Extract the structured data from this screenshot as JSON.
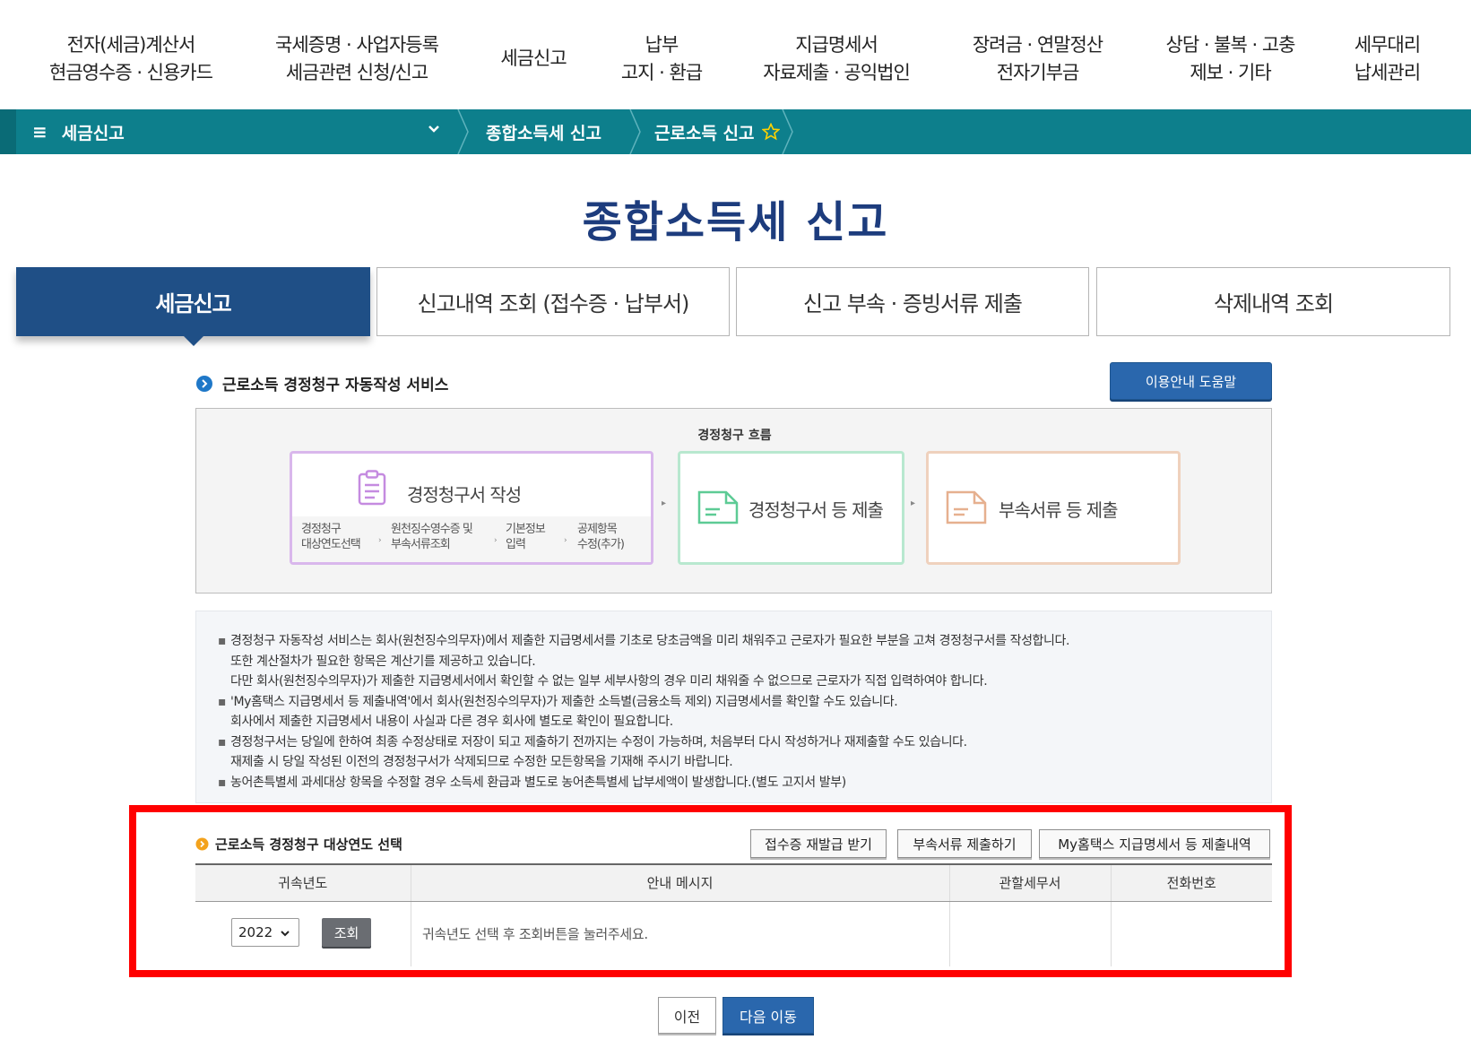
{
  "topnav": [
    {
      "line1": "전자(세금)계산서",
      "line2": "현금영수증 · 신용카드"
    },
    {
      "line1": "국세증명 · 사업자등록",
      "line2": "세금관련 신청/신고"
    },
    {
      "line1": "세금신고",
      "line2": ""
    },
    {
      "line1": "납부",
      "line2": "고지 · 환급"
    },
    {
      "line1": "지급명세서",
      "line2": "자료제출 · 공익법인"
    },
    {
      "line1": "장려금 · 연말정산",
      "line2": "전자기부금"
    },
    {
      "line1": "상담 · 불복 · 고충",
      "line2": "제보 · 기타"
    },
    {
      "line1": "세무대리",
      "line2": "납세관리"
    }
  ],
  "breadcrumb": {
    "menu_icon": "≡",
    "menu_label": "세금신고",
    "item1": "종합소득세 신고",
    "item2": "근로소득 신고"
  },
  "page_title": "종합소득세 신고",
  "tabs": [
    {
      "label": "세금신고",
      "active": true
    },
    {
      "label": "신고내역 조회 (접수증 · 납부서)",
      "active": false
    },
    {
      "label": "신고 부속 · 증빙서류 제출",
      "active": false
    },
    {
      "label": "삭제내역 조회",
      "active": false
    }
  ],
  "service": {
    "heading": "근로소득 경정청구 자동작성 서비스",
    "help_button": "이용안내 도움말"
  },
  "flow": {
    "title": "경정청구 흐름",
    "step1": "경정청구서 작성",
    "step1_subs": [
      {
        "line1": "경정청구",
        "line2": "대상연도선택"
      },
      {
        "line1": "원천징수영수증 및",
        "line2": "부속서류조회"
      },
      {
        "line1": "기본정보",
        "line2": "입력"
      },
      {
        "line1": "공제항목",
        "line2": "수정(추가)"
      }
    ],
    "step2": "경정청구서 등 제출",
    "step3": "부속서류 등 제출",
    "colors": {
      "step1": "#d9b7ec",
      "step2": "#b8e8cf",
      "step3": "#efd1bd"
    }
  },
  "notes": [
    {
      "bullet": true,
      "text": "경정청구 자동작성 서비스는 회사(원천징수의무자)에서 제출한 지급명세서를 기초로 당초금액을 미리 채워주고 근로자가 필요한 부분을 고쳐 경정청구서를 작성합니다."
    },
    {
      "bullet": false,
      "text": "또한 계산절차가 필요한 항목은 계산기를 제공하고 있습니다."
    },
    {
      "bullet": false,
      "text": "다만 회사(원천징수의무자)가 제출한 지급명세서에서 확인할 수 없는 일부 세부사항의 경우 미리 채워줄 수 없으므로 근로자가 직접 입력하여야 합니다."
    },
    {
      "bullet": true,
      "text": "'My홈택스 지급명세서 등 제출내역'에서 회사(원천징수의무자)가 제출한 소득별(금융소득 제외) 지급명세서를 확인할 수도 있습니다."
    },
    {
      "bullet": false,
      "text": "회사에서 제출한 지급명세서 내용이 사실과 다른 경우 회사에 별도로 확인이 필요합니다."
    },
    {
      "bullet": true,
      "text": "경정청구서는 당일에 한하여 최종 수정상태로 저장이 되고 제출하기 전까지는 수정이 가능하며, 처음부터 다시 작성하거나 재제출할 수도 있습니다."
    },
    {
      "bullet": false,
      "text": "재제출 시 당일 작성된 이전의 경정청구서가 삭제되므로 수정한 모든항목을 기재해 주시기 바랍니다."
    },
    {
      "bullet": true,
      "text": "농어촌특별세 과세대상 항목을 수정할 경우 소득세 환급과 별도로 농어촌특별세 납부세액이 발생합니다.(별도 고지서 발부)"
    }
  ],
  "year_select": {
    "heading": "근로소득 경정청구 대상연도 선택",
    "buttons": [
      "접수증 재발급 받기",
      "부속서류 제출하기",
      "My홈택스 지급명세서 등 제출내역"
    ],
    "columns": [
      "귀속년도",
      "안내 메시지",
      "관할세무서",
      "전화번호"
    ],
    "selected_year": "2022",
    "query_button": "조회",
    "message": "귀속년도 선택 후 조회버튼을 눌러주세요.",
    "tax_office": "",
    "phone": ""
  },
  "footer_buttons": {
    "prev": "이전",
    "next": "다음 이동"
  },
  "colors": {
    "breadcrumb_bg": "#0d7f8c",
    "title": "#1d3c7d",
    "active_tab": "#1f4f86",
    "primary_button": "#2a67ad",
    "highlight": "#ff0000"
  },
  "icons": [
    "hamburger-icon",
    "chevron-down-icon",
    "star-outline-icon",
    "arrow-circle-icon",
    "clipboard-icon",
    "document-icon",
    "caret-down-icon"
  ]
}
